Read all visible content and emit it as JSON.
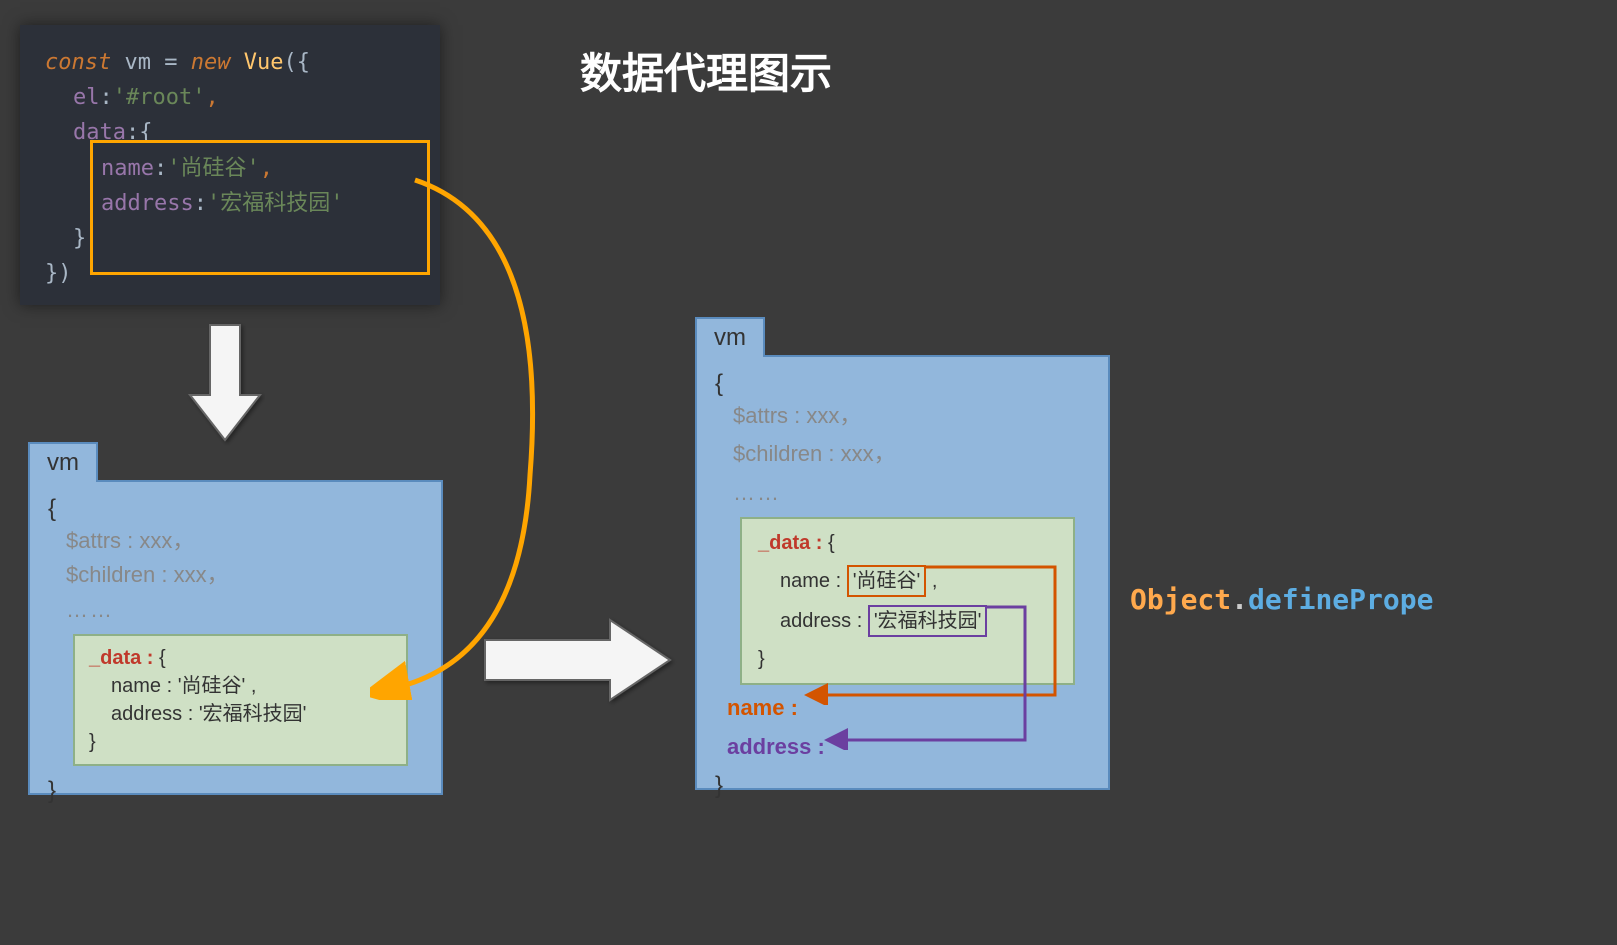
{
  "title": "数据代理图示",
  "code": {
    "const_kw": "const",
    "vm_var": "vm",
    "equals": "=",
    "new_kw": "new",
    "vue_class": "Vue",
    "el_prop": "el",
    "el_value": "'#root'",
    "data_prop": "data",
    "name_prop": "name",
    "name_value": "'尚硅谷'",
    "address_prop": "address",
    "address_value": "'宏福科技园'"
  },
  "vm_panels": {
    "tab_label": "vm",
    "brace_open": "{",
    "brace_close": "}",
    "attrs": "$attrs : xxx，",
    "children": "$children : xxx，",
    "dots": "……",
    "data_label": "_data : ",
    "inner_brace_open": "{",
    "inner_brace_close": "}",
    "name_line": "name : '尚硅谷' ,",
    "address_line": "address : '宏福科技园'",
    "name_prefix": "name : ",
    "name_val": "'尚硅谷'",
    "name_comma": " ,",
    "address_prefix": "address : ",
    "address_val": "'宏福科技园'"
  },
  "proxy": {
    "name_label": "name :",
    "address_label": "address :"
  },
  "define_property": {
    "object": "Object",
    "dot": ".",
    "method": "definePrope"
  }
}
